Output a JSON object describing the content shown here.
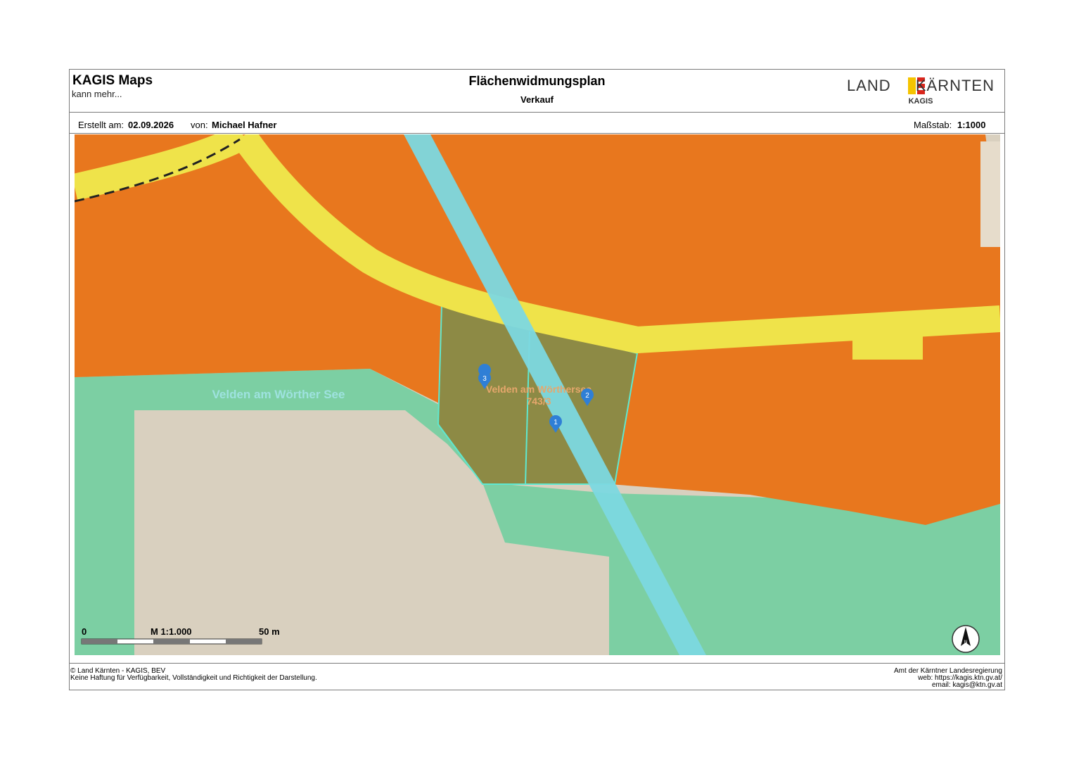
{
  "header": {
    "app_title": "KAGIS Maps",
    "app_subtitle": "kann mehr...",
    "map_title": "Flächenwidmungsplan",
    "map_subtitle": "Verkauf",
    "logo": {
      "left": "LAND",
      "right": "KÄRNTEN",
      "sub": "KAGIS",
      "colors": [
        "#f5c400",
        "#d9261c"
      ]
    }
  },
  "meta": {
    "created_label": "Erstellt am:",
    "created_value": "02.09.2026",
    "author_label": "von:",
    "author_value": "Michael Hafner",
    "scale_label": "Maßstab:",
    "scale_value": "1:1000"
  },
  "map": {
    "place_label": "Velden am Wörther See",
    "parcel_label_line1": "Velden am Wörthersee",
    "parcel_label_line2": "743/3",
    "markers": [
      "1",
      "2",
      "3"
    ],
    "scalebar": {
      "start": "0",
      "middle": "M 1:1.000",
      "end": "50 m"
    },
    "north": "N",
    "colors": {
      "building_zone": "#e8771e",
      "traffic_zone": "#efe34a",
      "green_zone": "#7ccfa3",
      "parcel_fill": "#8d8a45",
      "parcel_outline": "#5fe8d0",
      "water_strip": "#7cd8e0",
      "open_land": "#d9d0bf",
      "marker": "#2f7fd6"
    }
  },
  "footer": {
    "left_line1": "© Land Kärnten - KAGIS, BEV",
    "left_line2": "Keine Haftung für Verfügbarkeit, Vollständigkeit und Richtigkeit der Darstellung.",
    "right_line1": "Amt der Kärntner Landesregierung",
    "right_line2": "web: https://kagis.ktn.gv.at/",
    "right_line3": "email: kagis@ktn.gv.at"
  }
}
